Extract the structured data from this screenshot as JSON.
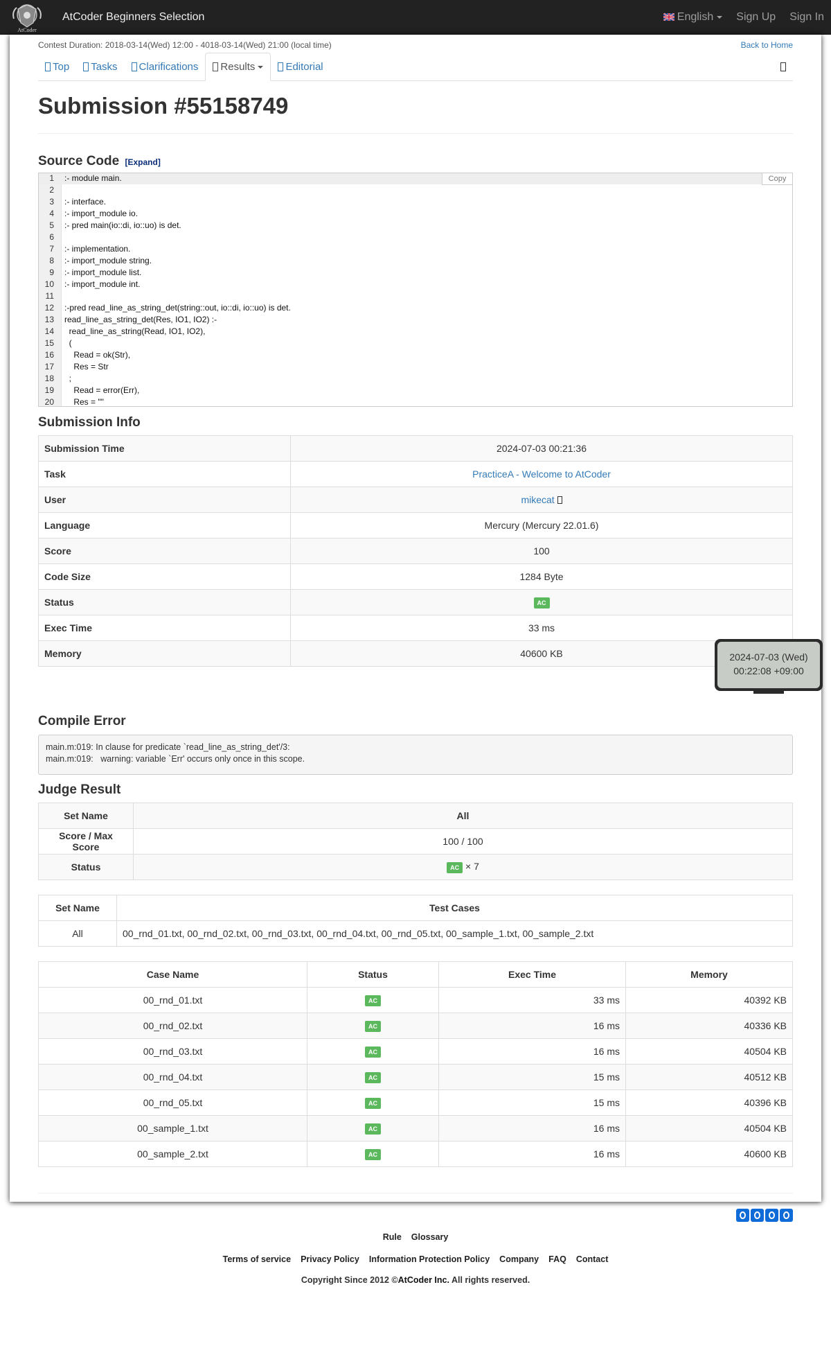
{
  "navbar": {
    "brand": "AtCoder Beginners Selection",
    "logo_text": "AtCoder",
    "language": "English",
    "sign_up": "Sign Up",
    "sign_in": "Sign In"
  },
  "contest": {
    "duration": "Contest Duration: 2018-03-14(Wed) 12:00 - 4018-03-14(Wed) 21:00 (local time)",
    "back_home": "Back to Home"
  },
  "tabs": [
    {
      "label": "Top"
    },
    {
      "label": "Tasks"
    },
    {
      "label": "Clarifications"
    },
    {
      "label": "Results"
    },
    {
      "label": "Editorial"
    }
  ],
  "page_title": "Submission #55158749",
  "source": {
    "heading": "Source Code",
    "expand": "[Expand]",
    "copy": "Copy",
    "lines": [
      ":- module main.",
      "",
      ":- interface.",
      ":- import_module io.",
      ":- pred main(io::di, io::uo) is det.",
      "",
      ":- implementation.",
      ":- import_module string.",
      ":- import_module list.",
      ":- import_module int.",
      "",
      ":-pred read_line_as_string_det(string::out, io::di, io::uo) is det.",
      "read_line_as_string_det(Res, IO1, IO2) :-",
      "  read_line_as_string(Read, IO1, IO2),",
      "  (",
      "    Read = ok(Str),",
      "    Res = Str",
      "  ;",
      "    Read = error(Err),",
      "    Res = \"\""
    ]
  },
  "info": {
    "heading": "Submission Info",
    "rows": [
      {
        "label": "Submission Time",
        "value": "2024-07-03 00:21:36"
      },
      {
        "label": "Task",
        "value": "PracticeA - Welcome to AtCoder"
      },
      {
        "label": "User",
        "value": "mikecat"
      },
      {
        "label": "Language",
        "value": "Mercury (Mercury 22.01.6)"
      },
      {
        "label": "Score",
        "value": "100"
      },
      {
        "label": "Code Size",
        "value": "1284 Byte"
      },
      {
        "label": "Status",
        "value": "AC"
      },
      {
        "label": "Exec Time",
        "value": "33 ms"
      },
      {
        "label": "Memory",
        "value": "40600 KB"
      }
    ]
  },
  "tooltip": {
    "line1": "2024-07-03 (Wed)",
    "line2": "00:22:08 +09:00"
  },
  "compile": {
    "heading": "Compile Error",
    "text": "main.m:019: In clause for predicate `read_line_as_string_det'/3:\nmain.m:019:   warning: variable `Err' occurs only once in this scope."
  },
  "judge": {
    "heading": "Judge Result",
    "set_name_label": "Set Name",
    "set_name_value": "All",
    "score_label": "Score / Max Score",
    "score_value": "100 / 100",
    "status_label": "Status",
    "status_value": "AC",
    "status_count": "× 7"
  },
  "case_sets": {
    "headers": [
      "Set Name",
      "Test Cases"
    ],
    "rows": [
      {
        "set": "All",
        "cases": "00_rnd_01.txt, 00_rnd_02.txt, 00_rnd_03.txt, 00_rnd_04.txt, 00_rnd_05.txt, 00_sample_1.txt, 00_sample_2.txt"
      }
    ]
  },
  "cases": {
    "headers": [
      "Case Name",
      "Status",
      "Exec Time",
      "Memory"
    ],
    "rows": [
      {
        "name": "00_rnd_01.txt",
        "status": "AC",
        "time": "33 ms",
        "memory": "40392 KB"
      },
      {
        "name": "00_rnd_02.txt",
        "status": "AC",
        "time": "16 ms",
        "memory": "40336 KB"
      },
      {
        "name": "00_rnd_03.txt",
        "status": "AC",
        "time": "16 ms",
        "memory": "40504 KB"
      },
      {
        "name": "00_rnd_04.txt",
        "status": "AC",
        "time": "15 ms",
        "memory": "40512 KB"
      },
      {
        "name": "00_rnd_05.txt",
        "status": "AC",
        "time": "15 ms",
        "memory": "40396 KB"
      },
      {
        "name": "00_sample_1.txt",
        "status": "AC",
        "time": "16 ms",
        "memory": "40504 KB"
      },
      {
        "name": "00_sample_2.txt",
        "status": "AC",
        "time": "16 ms",
        "memory": "40600 KB"
      }
    ]
  },
  "footer": {
    "links1": [
      "Rule",
      "Glossary"
    ],
    "links2": [
      "Terms of service",
      "Privacy Policy",
      "Information Protection Policy",
      "Company",
      "FAQ",
      "Contact"
    ],
    "copyright_prefix": "Copyright Since 2012 ©",
    "copyright_company": "AtCoder Inc.",
    "copyright_suffix": " All rights reserved."
  },
  "colors": {
    "navbar_bg": "#222222",
    "link": "#337ab7",
    "ac_label": "#5cb85c"
  }
}
